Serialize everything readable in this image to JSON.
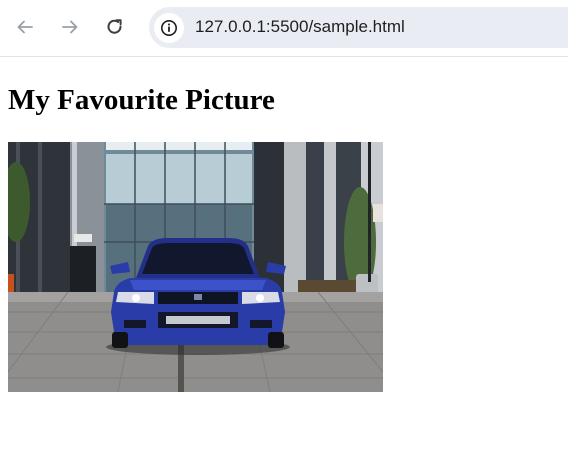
{
  "browser": {
    "url": "127.0.0.1:5500/sample.html",
    "icons": {
      "back": "back-arrow-icon",
      "forward": "forward-arrow-icon",
      "reload": "reload-icon",
      "site_info": "info-icon"
    }
  },
  "page": {
    "heading": "My Favourite Picture",
    "image": {
      "subject": "blue sports car parked in front of a glass building"
    }
  },
  "colors": {
    "car": "#2a3ca8",
    "omnibox": "#e9ecf3",
    "paving": "#8f8e8c"
  }
}
